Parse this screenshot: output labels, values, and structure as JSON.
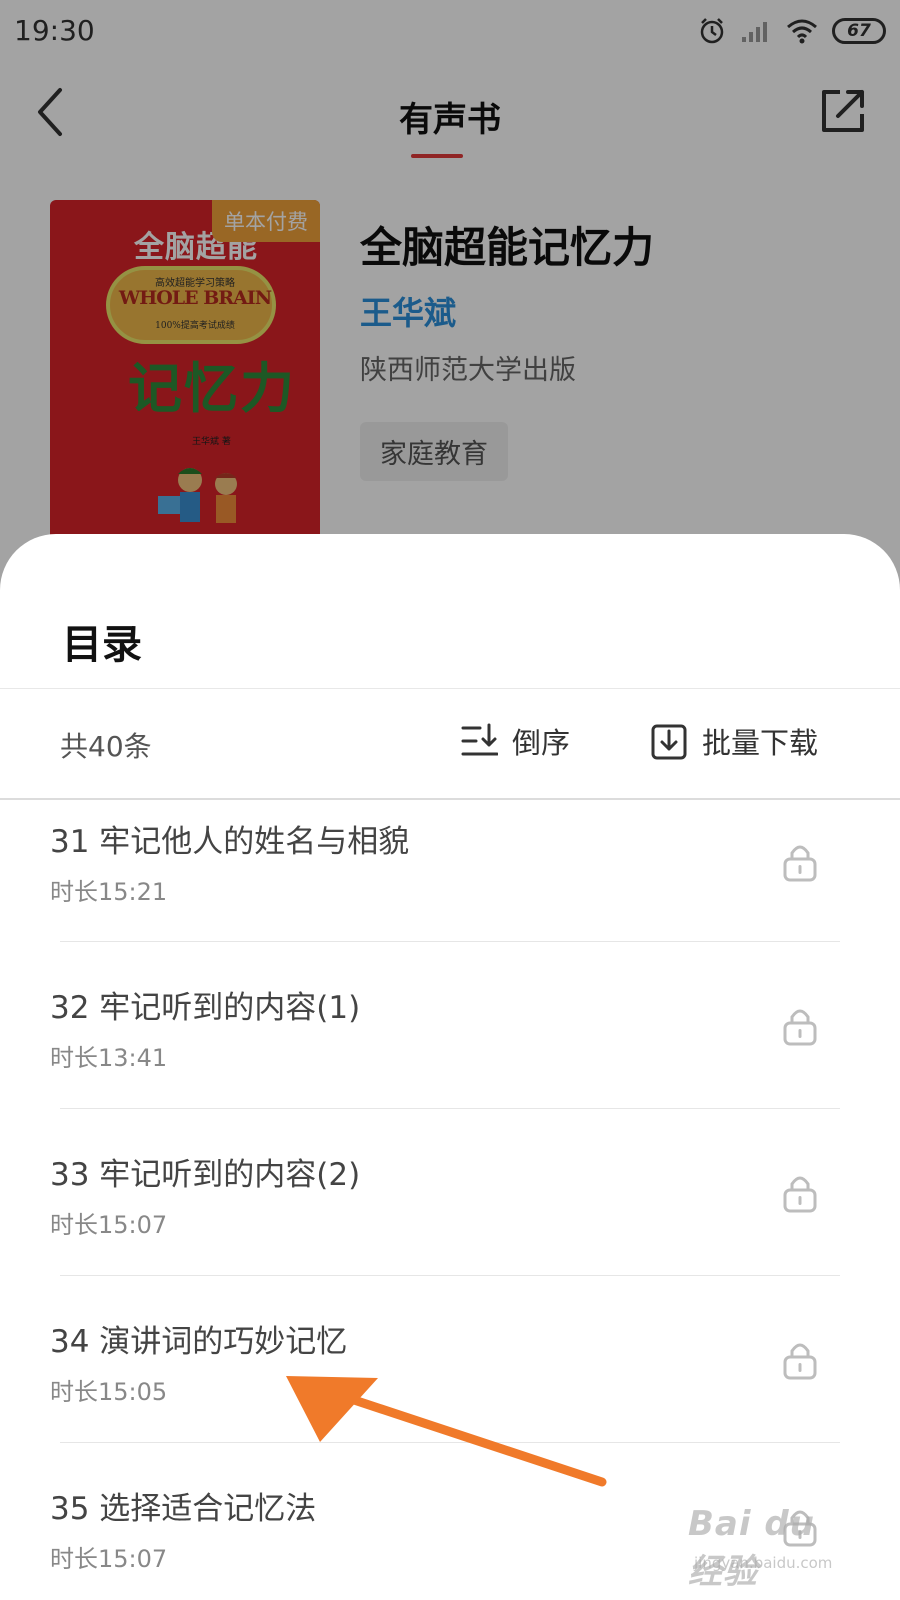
{
  "status_bar": {
    "time": "19:30",
    "battery": "67"
  },
  "nav": {
    "title": "有声书"
  },
  "book": {
    "cover": {
      "pay_tag": "单本付费",
      "title_top": "全脑超能",
      "subtitle_top": "高效超能学习策略",
      "brand": "WHOLE BRAIN",
      "subtitle_bottom": "100%提高考试成绩",
      "title_big": "记忆力",
      "author_line": "王华斌 著",
      "background_color": "#d8232a"
    },
    "title": "全脑超能记忆力",
    "author": "王华斌",
    "publisher": "陕西师范大学出版",
    "tag": "家庭教育"
  },
  "catalog": {
    "title": "目录",
    "total": "共40条",
    "sort_label": "倒序",
    "download_label": "批量下载",
    "episodes": [
      {
        "title": "31 牢记他人的姓名与相貌",
        "duration": "时长15:21",
        "locked": true
      },
      {
        "title": "32 牢记听到的内容(1)",
        "duration": "时长13:41",
        "locked": true
      },
      {
        "title": "33 牢记听到的内容(2)",
        "duration": "时长15:07",
        "locked": true
      },
      {
        "title": "34 演讲词的巧妙记忆",
        "duration": "时长15:05",
        "locked": true
      },
      {
        "title": "35 选择适合记忆法",
        "duration": "时长15:07",
        "locked": true
      }
    ]
  },
  "watermark": {
    "main": "Bai du 经验",
    "sub": "jingyan.baidu.com"
  },
  "colors": {
    "accent": "#e23b3b",
    "author_link": "#2b8fd9",
    "arrow": "#f07a2a"
  }
}
